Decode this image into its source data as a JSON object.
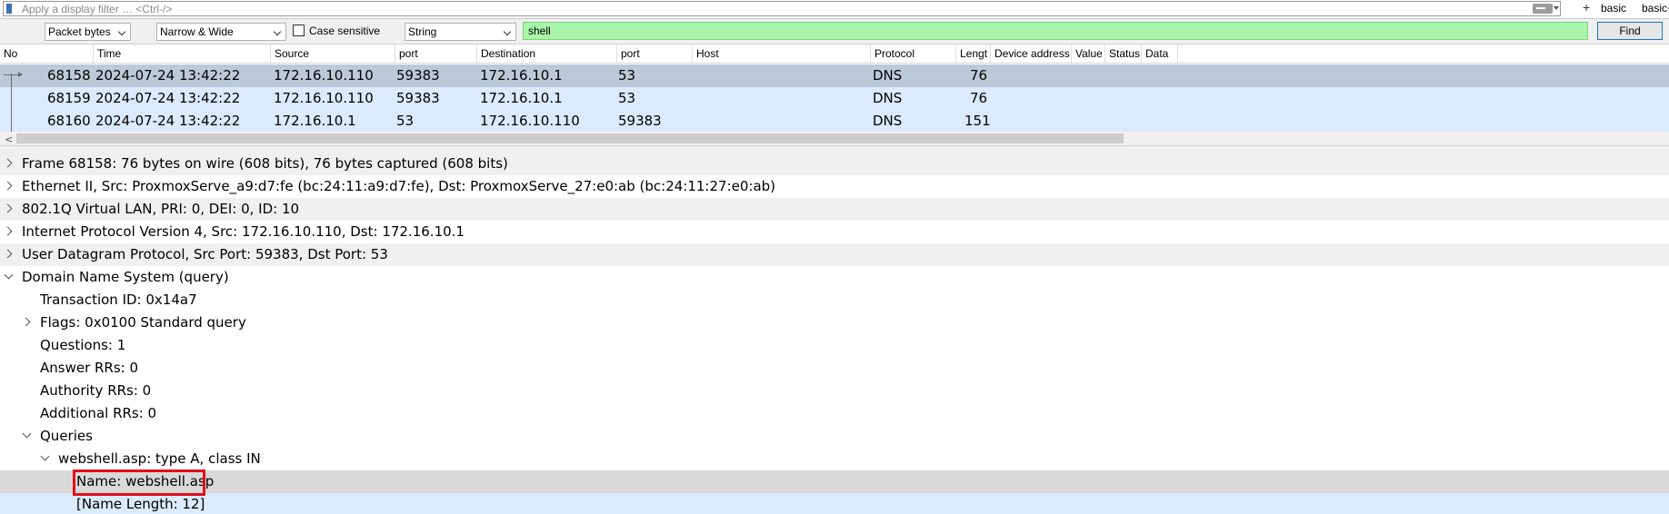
{
  "filter": {
    "placeholder": "Apply a display filter … <Ctrl-/>",
    "quick_filters": [
      "basic",
      "basic+"
    ]
  },
  "findbar": {
    "search_in": "Packet bytes",
    "char_width": "Narrow & Wide",
    "case_label": "Case sensitive",
    "search_type": "String",
    "search_value": "shell",
    "find_label": "Find"
  },
  "packet_list": {
    "columns": [
      "No",
      "Time",
      "Source",
      "port",
      "Destination",
      "port",
      "Host",
      "Protocol",
      "Lengt",
      "Device address",
      "Value",
      "Status",
      "Data"
    ],
    "rows": [
      {
        "no": "68158",
        "time": "2024-07-24 13:42:22",
        "src": "172.16.10.110",
        "sport": "59383",
        "dst": "172.16.10.1",
        "dport": "53",
        "proto": "DNS",
        "len": "76"
      },
      {
        "no": "68159",
        "time": "2024-07-24 13:42:22",
        "src": "172.16.10.110",
        "sport": "59383",
        "dst": "172.16.10.1",
        "dport": "53",
        "proto": "DNS",
        "len": "76"
      },
      {
        "no": "68160",
        "time": "2024-07-24 13:42:22",
        "src": "172.16.10.1",
        "sport": "53",
        "dst": "172.16.10.110",
        "dport": "59383",
        "proto": "DNS",
        "len": "151"
      }
    ]
  },
  "details": [
    "Frame 68158: 76 bytes on wire (608 bits), 76 bytes captured (608 bits)",
    "Ethernet II, Src: ProxmoxServe_a9:d7:fe (bc:24:11:a9:d7:fe), Dst: ProxmoxServe_27:e0:ab (bc:24:11:27:e0:ab)",
    "802.1Q Virtual LAN, PRI: 0, DEI: 0, ID: 10",
    "Internet Protocol Version 4, Src: 172.16.10.110, Dst: 172.16.10.1",
    "User Datagram Protocol, Src Port: 59383, Dst Port: 53",
    "Domain Name System (query)",
    "Transaction ID: 0x14a7",
    "Flags: 0x0100 Standard query",
    "Questions: 1",
    "Answer RRs: 0",
    "Authority RRs: 0",
    "Additional RRs: 0",
    "Queries",
    "webshell.asp: type A, class IN",
    "Name: webshell.asp",
    "[Name Length: 12]"
  ],
  "colors": {
    "selected_row": "#bccad7",
    "packet_row": "#dbeafc",
    "search_highlight": "#a8f5a8",
    "annotation_box": "#e0101a"
  }
}
